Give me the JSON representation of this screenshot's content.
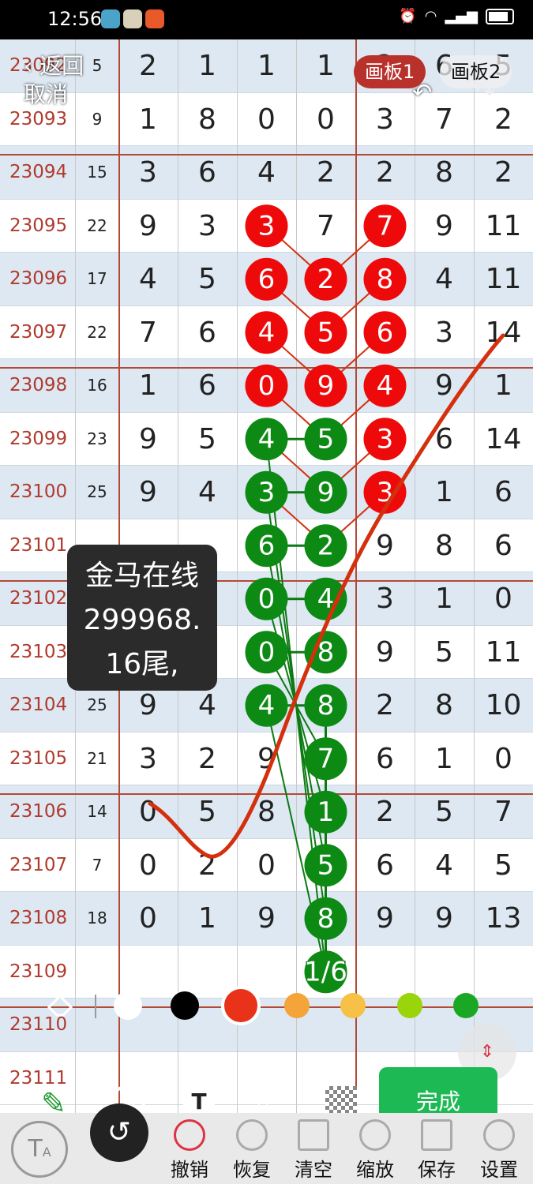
{
  "status_bar": {
    "time": "12:56"
  },
  "header": {
    "back_label": "返回",
    "cancel_label": "取消",
    "tab1_label": "画板1",
    "tab2_label": "画板2"
  },
  "rows": [
    {
      "issue": "23092",
      "sum": "5",
      "nums": [
        "2",
        "1",
        "1",
        "1",
        "2",
        "6",
        "5"
      ]
    },
    {
      "issue": "23093",
      "sum": "9",
      "nums": [
        "1",
        "8",
        "0",
        "0",
        "3",
        "7",
        "2"
      ]
    },
    {
      "issue": "23094",
      "sum": "15",
      "nums": [
        "3",
        "6",
        "4",
        "2",
        "2",
        "8",
        "2"
      ]
    },
    {
      "issue": "23095",
      "sum": "22",
      "nums": [
        "9",
        "3",
        "3",
        "7",
        "7",
        "9",
        "11"
      ]
    },
    {
      "issue": "23096",
      "sum": "17",
      "nums": [
        "4",
        "5",
        "6",
        "2",
        "8",
        "4",
        "11"
      ]
    },
    {
      "issue": "23097",
      "sum": "22",
      "nums": [
        "7",
        "6",
        "4",
        "5",
        "6",
        "3",
        "14"
      ]
    },
    {
      "issue": "23098",
      "sum": "16",
      "nums": [
        "1",
        "6",
        "0",
        "9",
        "4",
        "9",
        "1"
      ]
    },
    {
      "issue": "23099",
      "sum": "23",
      "nums": [
        "9",
        "5",
        "4",
        "5",
        "3",
        "6",
        "14"
      ]
    },
    {
      "issue": "23100",
      "sum": "25",
      "nums": [
        "9",
        "4",
        "3",
        "9",
        "3",
        "1",
        "6"
      ]
    },
    {
      "issue": "23101",
      "sum": "",
      "nums": [
        "",
        "",
        "6",
        "2",
        "9",
        "8",
        "6"
      ]
    },
    {
      "issue": "23102",
      "sum": "",
      "nums": [
        "",
        "",
        "0",
        "4",
        "3",
        "1",
        "0"
      ]
    },
    {
      "issue": "23103",
      "sum": "",
      "nums": [
        "",
        "",
        "0",
        "8",
        "9",
        "5",
        "11"
      ]
    },
    {
      "issue": "23104",
      "sum": "25",
      "nums": [
        "9",
        "4",
        "4",
        "8",
        "2",
        "8",
        "10"
      ]
    },
    {
      "issue": "23105",
      "sum": "21",
      "nums": [
        "3",
        "2",
        "9",
        "7",
        "6",
        "1",
        "0"
      ]
    },
    {
      "issue": "23106",
      "sum": "14",
      "nums": [
        "0",
        "5",
        "8",
        "1",
        "2",
        "5",
        "7"
      ]
    },
    {
      "issue": "23107",
      "sum": "7",
      "nums": [
        "0",
        "2",
        "0",
        "5",
        "6",
        "4",
        "5"
      ]
    },
    {
      "issue": "23108",
      "sum": "18",
      "nums": [
        "0",
        "1",
        "9",
        "8",
        "9",
        "9",
        "13"
      ]
    },
    {
      "issue": "23109",
      "sum": "",
      "nums": [
        "",
        "",
        "",
        "1/6",
        "",
        "",
        ""
      ]
    },
    {
      "issue": "23110",
      "sum": "",
      "nums": [
        "",
        "",
        "",
        "",
        "",
        "",
        ""
      ]
    },
    {
      "issue": "23111",
      "sum": "",
      "nums": [
        "",
        "",
        "",
        "",
        "",
        "",
        ""
      ]
    }
  ],
  "tooltip": {
    "line1": "金马在线",
    "line2": "299968.",
    "line3": "16尾,"
  },
  "palette": {
    "colors": [
      "#ffffff",
      "#000000",
      "#e8331a",
      "#f5a43a",
      "#f7c046",
      "#9ad40a",
      "#1aa824"
    ],
    "selected": "#e8331a"
  },
  "done_label": "完成",
  "bottom": {
    "undo": "撤销",
    "redo": "恢复",
    "clear": "清空",
    "zoom": "缩放",
    "save": "保存",
    "settings": "设置"
  },
  "colors": {
    "red_circle": "#ee0a0a",
    "green_circle": "#0d8a14",
    "red_line": "#d4300e",
    "green_line": "#0b7a12"
  }
}
